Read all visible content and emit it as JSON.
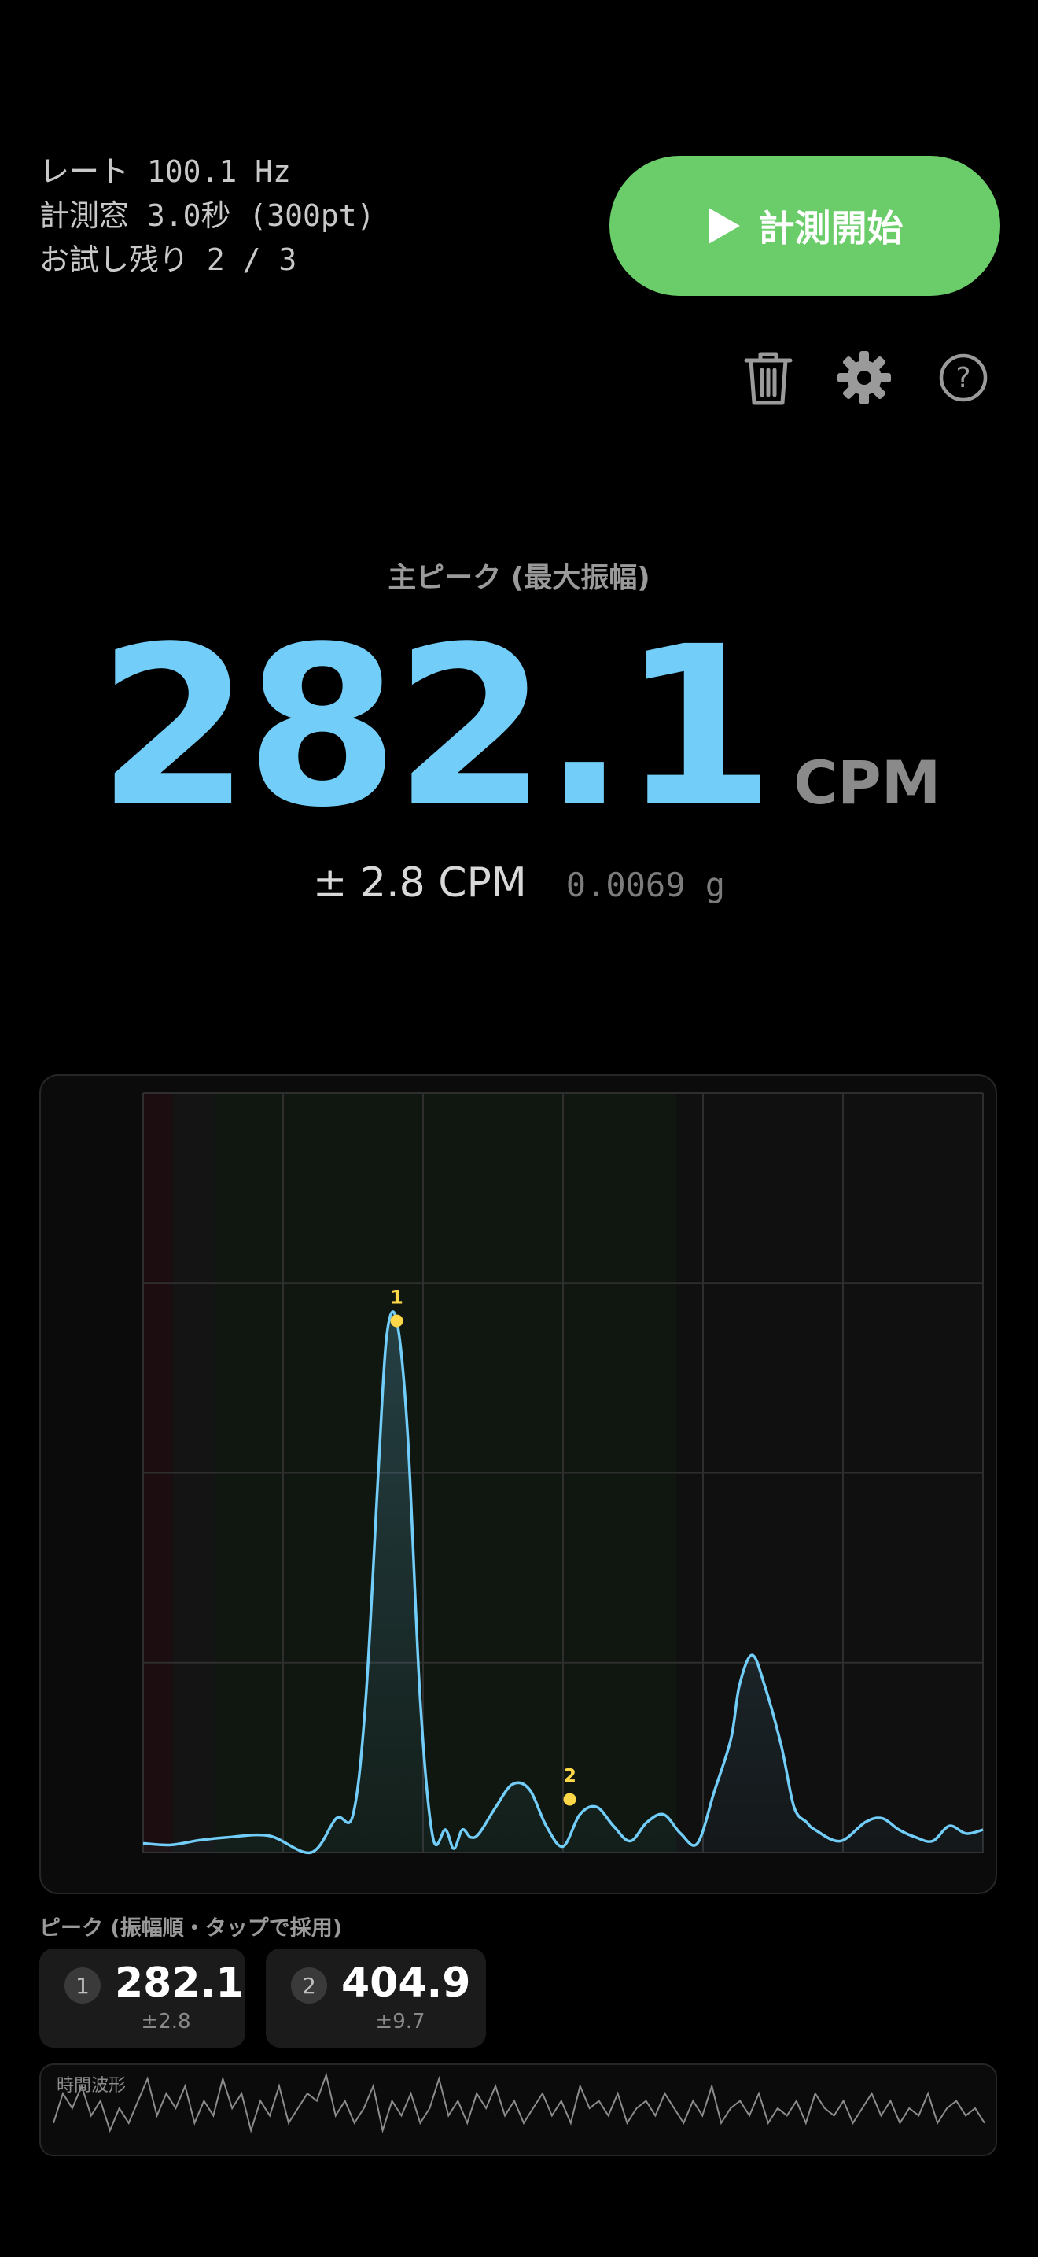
{
  "info": {
    "rate": "レート 100.1 Hz",
    "window": "計測窓 3.0秒 (300pt)",
    "trials": "お試し残り 2 / 3"
  },
  "start_button": {
    "label": "計測開始",
    "icon": "play-icon"
  },
  "toolbar": {
    "icons": [
      "trash-icon",
      "gear-icon",
      "help-icon"
    ]
  },
  "main": {
    "label": "主ピーク (最大振幅)",
    "value": "282.1",
    "unit": "CPM",
    "error": "± 2.8 CPM",
    "amplitude": "0.0069 g"
  },
  "colors": {
    "accent": "#72cdf8",
    "button": "#6acd6a",
    "peak_marker": "#ffd84a"
  },
  "chart_data": {
    "type": "area",
    "series_color": "#72cdf8",
    "grid": true,
    "x": [
      0,
      0.033,
      0.066,
      0.1,
      0.15,
      0.2,
      0.23,
      0.25,
      0.265,
      0.28,
      0.29,
      0.302,
      0.315,
      0.33,
      0.345,
      0.36,
      0.37,
      0.38,
      0.39,
      0.4,
      0.42,
      0.44,
      0.46,
      0.48,
      0.5,
      0.52,
      0.54,
      0.56,
      0.58,
      0.6,
      0.62,
      0.64,
      0.66,
      0.68,
      0.7,
      0.71,
      0.725,
      0.74,
      0.76,
      0.775,
      0.79,
      0.8,
      0.83,
      0.86,
      0.88,
      0.9,
      0.92,
      0.94,
      0.96,
      0.98,
      1.0
    ],
    "y": [
      0.012,
      0.01,
      0.016,
      0.02,
      0.022,
      0.0,
      0.045,
      0.05,
      0.2,
      0.5,
      0.68,
      0.7,
      0.55,
      0.2,
      0.02,
      0.03,
      0.005,
      0.03,
      0.02,
      0.025,
      0.06,
      0.09,
      0.083,
      0.035,
      0.008,
      0.05,
      0.06,
      0.035,
      0.015,
      0.04,
      0.05,
      0.025,
      0.012,
      0.08,
      0.15,
      0.22,
      0.26,
      0.22,
      0.14,
      0.06,
      0.04,
      0.03,
      0.015,
      0.04,
      0.045,
      0.03,
      0.02,
      0.015,
      0.035,
      0.025,
      0.03
    ],
    "peaks": [
      {
        "rank": "1",
        "x": 0.302,
        "y": 0.7
      },
      {
        "rank": "2",
        "x": 0.508,
        "y": 0.07
      }
    ],
    "ylim": [
      0,
      1
    ],
    "xlim": [
      0,
      1
    ],
    "grid_lines_x": 6,
    "grid_lines_y": 4,
    "bands": [
      {
        "from": 0,
        "to": 0.035,
        "color": "#1c0e10"
      },
      {
        "from": 0.035,
        "to": 0.085,
        "color": "#141414"
      },
      {
        "from": 0.085,
        "to": 0.635,
        "color": "#0f1710"
      },
      {
        "from": 0.635,
        "to": 1.0,
        "color": "#101010"
      }
    ]
  },
  "peaks_section": {
    "title": "ピーク (振幅順・タップで採用)",
    "items": [
      {
        "rank": "1",
        "value": "282.1",
        "error": "±2.8"
      },
      {
        "rank": "2",
        "value": "404.9",
        "error": "±9.7"
      }
    ]
  },
  "waveform": {
    "label": "時間波形",
    "values": [
      0.3,
      0.7,
      0.5,
      0.8,
      0.4,
      0.6,
      0.2,
      0.5,
      0.3,
      0.6,
      0.9,
      0.4,
      0.7,
      0.5,
      0.8,
      0.3,
      0.6,
      0.4,
      0.9,
      0.5,
      0.7,
      0.2,
      0.6,
      0.4,
      0.8,
      0.3,
      0.5,
      0.7,
      0.6,
      0.95,
      0.4,
      0.6,
      0.3,
      0.5,
      0.8,
      0.2,
      0.6,
      0.4,
      0.7,
      0.3,
      0.5,
      0.9,
      0.4,
      0.6,
      0.3,
      0.7,
      0.5,
      0.8,
      0.4,
      0.6,
      0.3,
      0.5,
      0.7,
      0.4,
      0.6,
      0.3,
      0.8,
      0.5,
      0.6,
      0.4,
      0.7,
      0.3,
      0.5,
      0.6,
      0.4,
      0.7,
      0.5,
      0.3,
      0.6,
      0.4,
      0.8,
      0.3,
      0.5,
      0.6,
      0.4,
      0.7,
      0.3,
      0.5,
      0.4,
      0.6,
      0.3,
      0.7,
      0.5,
      0.4,
      0.6,
      0.3,
      0.5,
      0.7,
      0.4,
      0.6,
      0.3,
      0.5,
      0.4,
      0.7,
      0.3,
      0.5,
      0.6,
      0.4,
      0.5,
      0.3
    ]
  }
}
